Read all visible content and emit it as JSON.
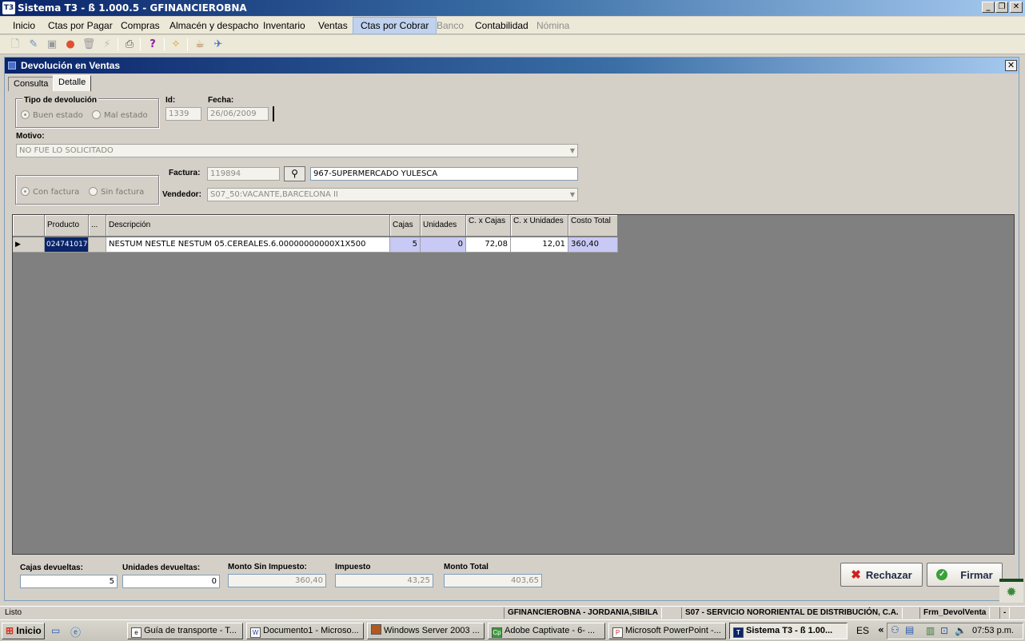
{
  "window": {
    "title": "Sistema T3 - ß 1.000.5 - GFINANCIEROBNA",
    "app_icon": "T3"
  },
  "menu": [
    {
      "label": "Inicio",
      "state": "normal"
    },
    {
      "label": "Ctas por Pagar",
      "state": "normal"
    },
    {
      "label": "Compras",
      "state": "normal"
    },
    {
      "label": "Almacén y despacho",
      "state": "normal"
    },
    {
      "label": "Inventario",
      "state": "normal"
    },
    {
      "label": "Ventas",
      "state": "normal"
    },
    {
      "label": "Ctas por Cobrar",
      "state": "active"
    },
    {
      "label": "Banco",
      "state": "disabled"
    },
    {
      "label": "Contabilidad",
      "state": "normal"
    },
    {
      "label": "Nómina",
      "state": "disabled"
    }
  ],
  "form": {
    "title": "Devolución en Ventas",
    "tabs": [
      "Consulta",
      "Detalle"
    ],
    "tipo_label": "Tipo de devolución",
    "tipo_options": [
      "Buen estado",
      "Mal estado"
    ],
    "id_label": "Id:",
    "id_value": "1339",
    "fecha_label": "Fecha:",
    "fecha_value": "26/06/2009",
    "motivo_label": "Motivo:",
    "motivo_value": "NO FUE LO SOLICITADO",
    "factura_options": [
      "Con factura",
      "Sin factura"
    ],
    "factura_label": "Factura:",
    "factura_value": "119894",
    "cliente_value": "967-SUPERMERCADO YULESCA",
    "vendedor_label": "Vendedor:",
    "vendedor_value": "S07_50:VACANTE,BARCELONA II"
  },
  "grid": {
    "headers": {
      "producto": "Producto",
      "dots": "...",
      "descripcion": "Descripción",
      "cajas": "Cajas",
      "unidades": "Unidades",
      "cx_cajas": "C. x Cajas",
      "cx_unidades": "C. x Unidades",
      "costo_total": "Costo Total"
    },
    "rows": [
      {
        "producto": "024741017",
        "descripcion": "NESTUM NESTLE NESTUM 05.CEREALES.6.00000000000X1X500",
        "cajas": "5",
        "unidades": "0",
        "cx_cajas": "72,08",
        "cx_unidades": "12,01",
        "costo_total": "360,40"
      }
    ]
  },
  "totals": {
    "cajas_label": "Cajas devueltas:",
    "cajas_value": "5",
    "unidades_label": "Unidades devueltas:",
    "unidades_value": "0",
    "monto_sin_label": "Monto Sin Impuesto:",
    "monto_sin_value": "360,40",
    "impuesto_label": "Impuesto",
    "impuesto_value": "43,25",
    "monto_total_label": "Monto Total",
    "monto_total_value": "403,65"
  },
  "buttons": {
    "rechazar": "Rechazar",
    "firmar": "Firmar"
  },
  "statusbar": {
    "status": "Listo",
    "user": "GFINANCIEROBNA - JORDANIA,SIBILA",
    "company": "S07 - SERVICIO NORORIENTAL DE DISTRIBUCIÓN, C.A.",
    "form": "Frm_DevolVenta"
  },
  "taskbar": {
    "start": "Inicio",
    "tasks": [
      "Guía de transporte - T...",
      "Documento1 - Microso...",
      "Windows Server 2003 ...",
      "Adobe Captivate - 6- ...",
      "Microsoft PowerPoint -...",
      "Sistema T3 - ß 1.00..."
    ],
    "lang": "ES",
    "clock": "07:53 p.m."
  }
}
